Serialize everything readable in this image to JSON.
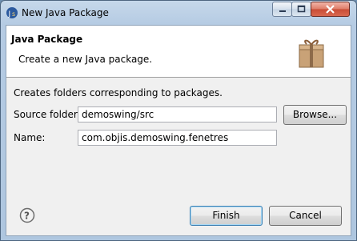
{
  "window": {
    "title": "New Java Package"
  },
  "banner": {
    "title": "Java Package",
    "message": "Create a new Java package."
  },
  "form": {
    "description": "Creates folders corresponding to packages.",
    "source_folder_label": "Source folder:",
    "source_folder_value": "demoswing/src",
    "browse_label": "Browse...",
    "name_label": "Name:",
    "name_value": "com.objis.demoswing.fenetres"
  },
  "footer": {
    "finish_label": "Finish",
    "cancel_label": "Cancel",
    "help_icon": "help-icon"
  },
  "colors": {
    "titlebar": "#b5cbe3",
    "close": "#c84c35",
    "dialog_bg": "#f0f0f0",
    "default_button_border": "#3c7fb1"
  }
}
